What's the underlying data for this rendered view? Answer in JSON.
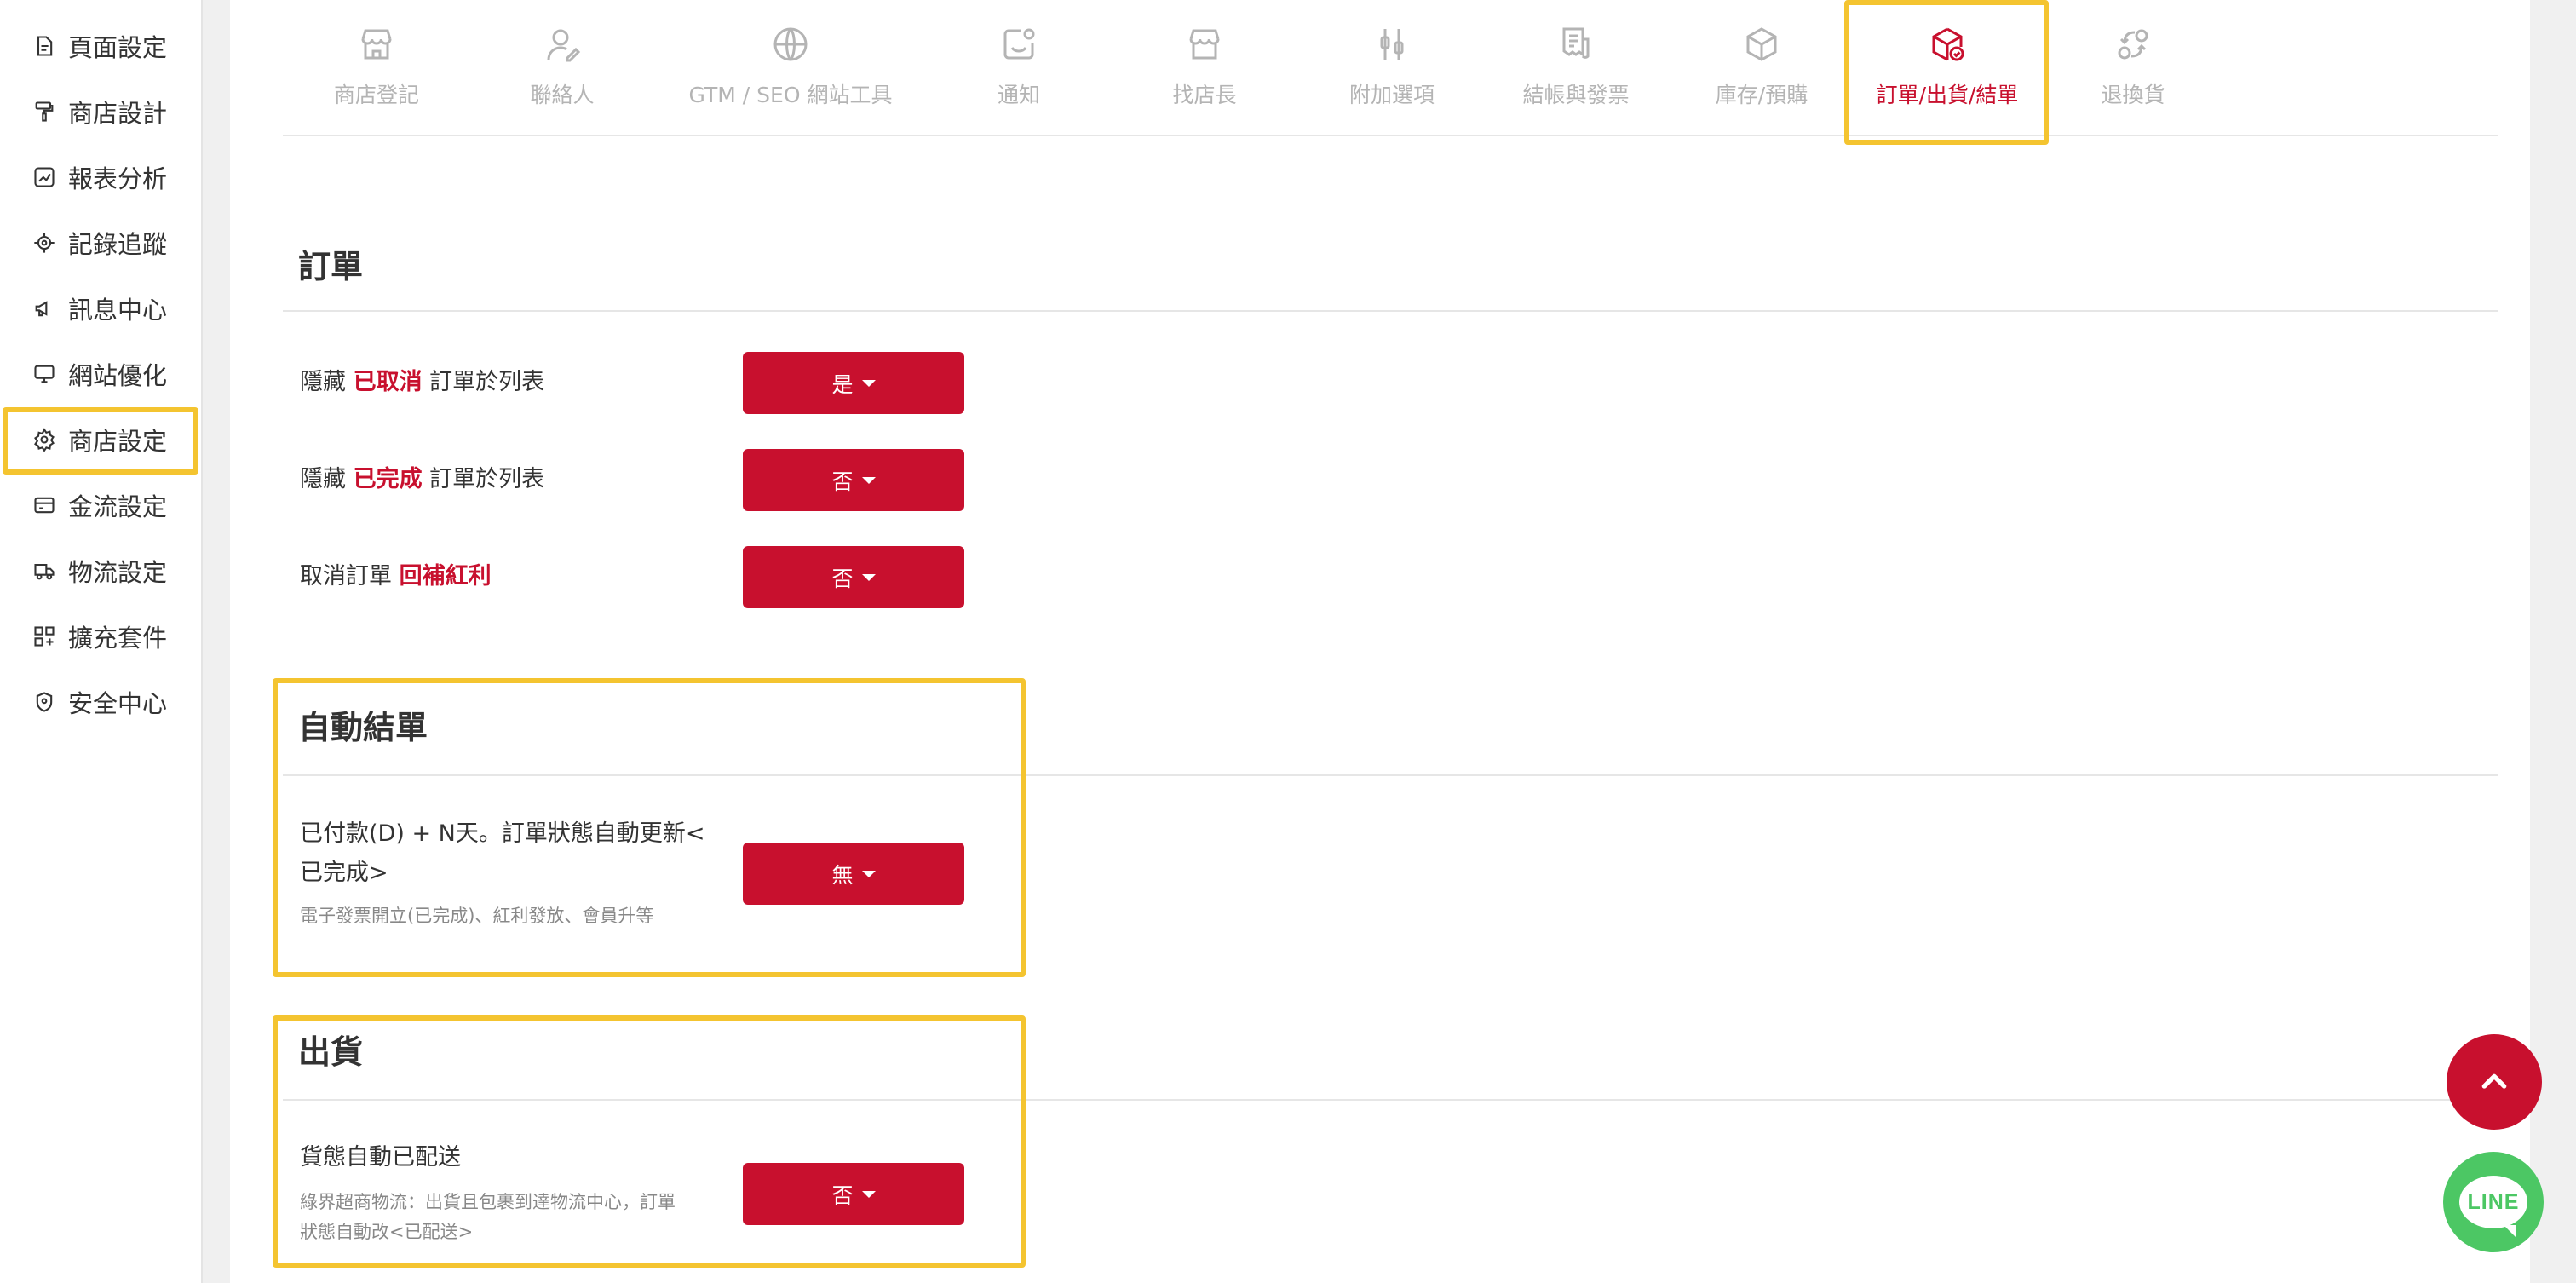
{
  "sidebar": {
    "items": [
      {
        "label": "頁面設定",
        "icon": "page-icon"
      },
      {
        "label": "商店設計",
        "icon": "paint-roller-icon"
      },
      {
        "label": "報表分析",
        "icon": "chart-icon"
      },
      {
        "label": "記錄追蹤",
        "icon": "target-icon"
      },
      {
        "label": "訊息中心",
        "icon": "megaphone-icon"
      },
      {
        "label": "網站優化",
        "icon": "monitor-icon"
      },
      {
        "label": "商店設定",
        "icon": "gear-icon"
      },
      {
        "label": "金流設定",
        "icon": "credit-card-icon"
      },
      {
        "label": "物流設定",
        "icon": "truck-icon"
      },
      {
        "label": "擴充套件",
        "icon": "grid-plus-icon"
      },
      {
        "label": "安全中心",
        "icon": "shield-icon"
      }
    ]
  },
  "tabs": [
    {
      "label": "商店登記",
      "icon": "storefront-icon"
    },
    {
      "label": "聯絡人",
      "icon": "person-edit-icon"
    },
    {
      "label": "GTM / SEO 網站工具",
      "icon": "globe-icon"
    },
    {
      "label": "通知",
      "icon": "notification-icon"
    },
    {
      "label": "找店長",
      "icon": "store-icon"
    },
    {
      "label": "附加選項",
      "icon": "sliders-icon"
    },
    {
      "label": "結帳與發票",
      "icon": "receipt-icon"
    },
    {
      "label": "庫存/預購",
      "icon": "box-icon"
    },
    {
      "label": "訂單/出貨/結單",
      "icon": "box-check-icon",
      "active": true
    },
    {
      "label": "退換貨",
      "icon": "return-icon"
    }
  ],
  "sections": {
    "order": {
      "title": "訂單",
      "rows": [
        {
          "pre": "隱藏 ",
          "em": "已取消",
          "post": " 訂單於列表",
          "value": "是"
        },
        {
          "pre": "隱藏 ",
          "em": "已完成",
          "post": " 訂單於列表",
          "value": "否"
        },
        {
          "pre": "取消訂單 ",
          "em": "回補紅利",
          "post": "",
          "value": "否"
        }
      ]
    },
    "auto_close": {
      "title": "自動結單",
      "label_line1": "已付款(D) + N天。訂單狀態自動更新<",
      "label_line2": "已完成>",
      "desc": "電子發票開立(已完成)、紅利發放、會員升等",
      "value": "無"
    },
    "shipping": {
      "title": "出貨",
      "label": "貨態自動已配送",
      "desc_line1": "綠界超商物流：出貨且包裹到達物流中心，訂單",
      "desc_line2": "狀態自動改<已配送>",
      "value": "否"
    }
  },
  "floating": {
    "scroll_top_icon": "chevron-up-icon",
    "line_label": "LINE"
  },
  "colors": {
    "accent": "#c8102e",
    "highlight": "#f4c430",
    "line_green": "#4cc764"
  }
}
